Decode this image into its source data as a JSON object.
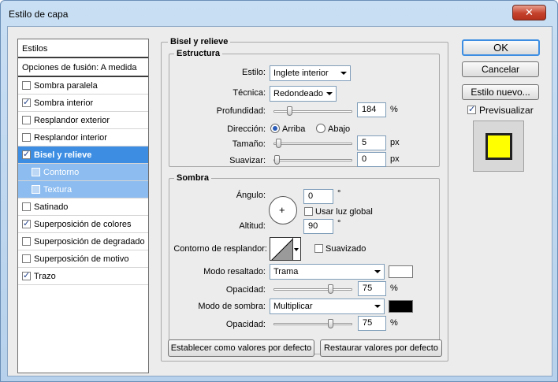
{
  "window": {
    "title": "Estilo de capa",
    "close_glyph": "✕"
  },
  "styles_panel": {
    "header": "Estilos",
    "blending": "Opciones de fusión: A medida",
    "items": [
      {
        "label": "Sombra paralela",
        "checked": false
      },
      {
        "label": "Sombra interior",
        "checked": true
      },
      {
        "label": "Resplandor exterior",
        "checked": false
      },
      {
        "label": "Resplandor interior",
        "checked": false
      },
      {
        "label": "Bisel y relieve",
        "checked": true,
        "selected": true
      },
      {
        "label": "Contorno",
        "checked": false,
        "sub": true
      },
      {
        "label": "Textura",
        "checked": false,
        "sub": true
      },
      {
        "label": "Satinado",
        "checked": false
      },
      {
        "label": "Superposición de colores",
        "checked": true
      },
      {
        "label": "Superposición de degradado",
        "checked": false
      },
      {
        "label": "Superposición de motivo",
        "checked": false
      },
      {
        "label": "Trazo",
        "checked": true
      }
    ]
  },
  "bevel": {
    "title": "Bisel y relieve",
    "structure": {
      "title": "Estructura",
      "style_label": "Estilo:",
      "style_value": "Inglete interior",
      "technique_label": "Técnica:",
      "technique_value": "Redondeado",
      "depth_label": "Profundidad:",
      "depth_value": "184",
      "depth_unit": "%",
      "depth_level": 0.18,
      "direction_label": "Dirección:",
      "direction_up": "Arriba",
      "direction_down": "Abajo",
      "size_label": "Tamaño:",
      "size_value": "5",
      "size_unit": "px",
      "size_level": 0.02,
      "soften_label": "Suavizar:",
      "soften_value": "0",
      "soften_unit": "px",
      "soften_level": 0.0
    },
    "shading": {
      "title": "Sombra",
      "angle_label": "Ángulo:",
      "angle_value": "0",
      "angle_unit": "°",
      "global_light_label": "Usar luz global",
      "altitude_label": "Altitud:",
      "altitude_value": "90",
      "altitude_unit": "°",
      "gloss_contour_label": "Contorno de resplandor:",
      "antialiased_label": "Suavizado",
      "highlight_mode_label": "Modo resaltado:",
      "highlight_mode_value": "Trama",
      "highlight_color": "#ffffff",
      "highlight_opacity_label": "Opacidad:",
      "highlight_opacity_value": "75",
      "highlight_opacity_unit": "%",
      "highlight_opacity_level": 0.75,
      "shadow_mode_label": "Modo de sombra:",
      "shadow_mode_value": "Multiplicar",
      "shadow_color": "#000000",
      "shadow_opacity_label": "Opacidad:",
      "shadow_opacity_value": "75",
      "shadow_opacity_unit": "%",
      "shadow_opacity_level": 0.75
    },
    "make_default": "Establecer como valores por defecto",
    "reset_default": "Restaurar valores por defecto"
  },
  "buttons": {
    "ok": "OK",
    "cancel": "Cancelar",
    "new_style": "Estilo nuevo...",
    "preview_label": "Previsualizar"
  },
  "colors": {
    "accent": "#3d8ee3",
    "preview_fill": "#ffff00"
  }
}
